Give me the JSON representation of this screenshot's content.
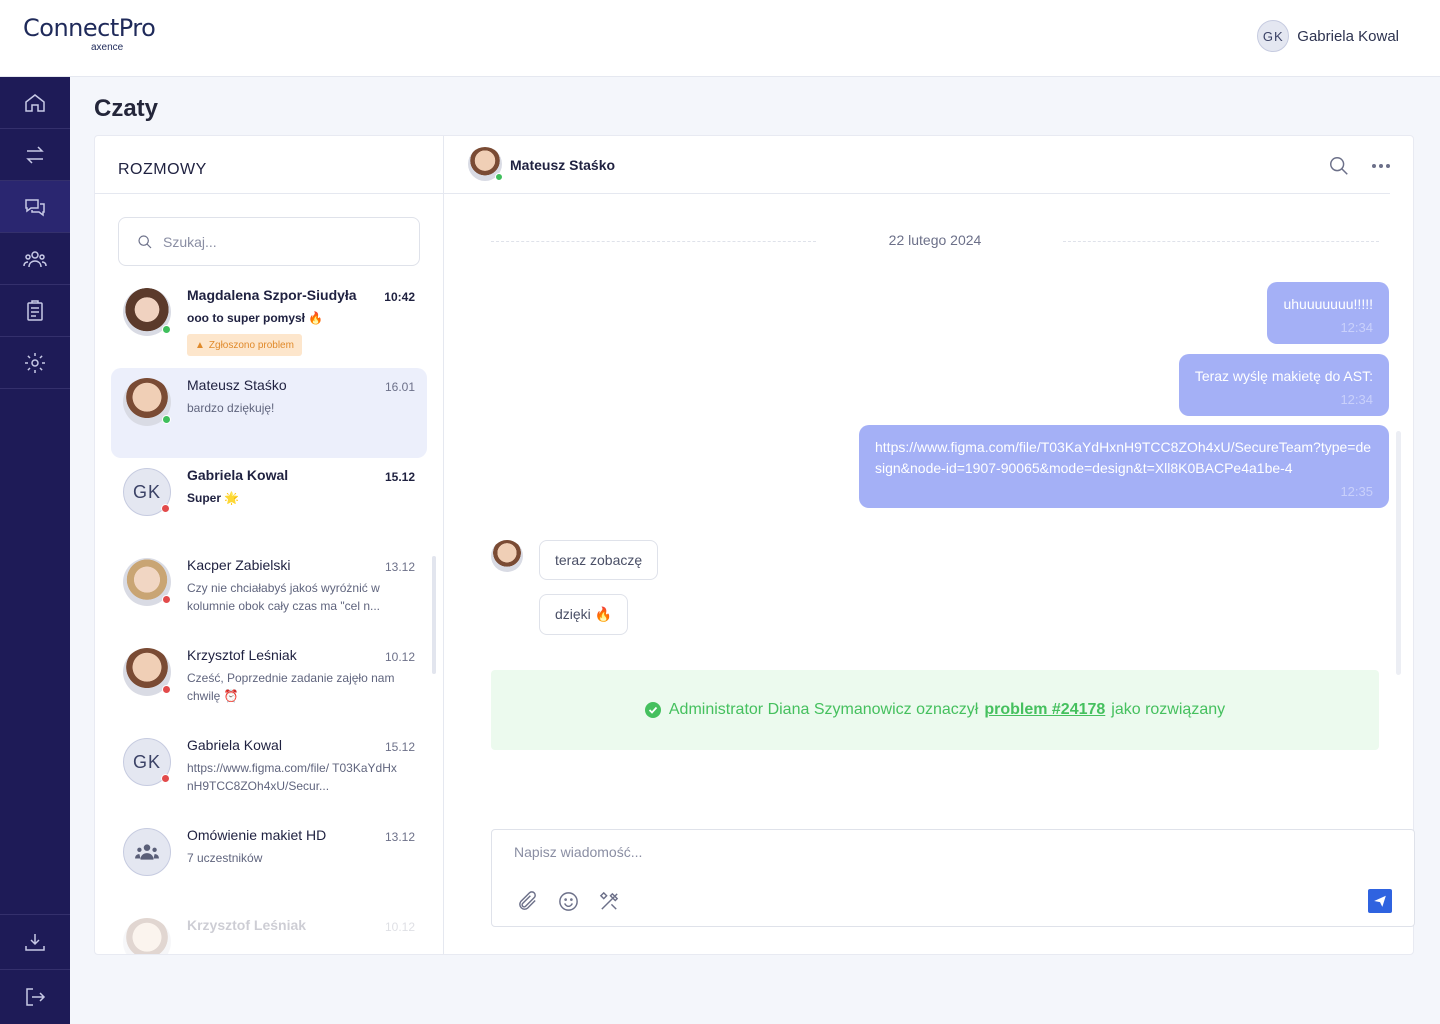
{
  "app": {
    "logo": "ConnectPro",
    "logo_sub": "axence"
  },
  "user": {
    "initials": "GK",
    "name": "Gabriela Kowal"
  },
  "page": {
    "title": "Czaty"
  },
  "conversations": {
    "heading": "ROZMOWY",
    "search_placeholder": "Szukaj...",
    "items": [
      {
        "name": "Magdalena Szpor-Siudyła",
        "time": "10:42",
        "message": "ooo to super pomysł 🔥",
        "badge": "Zgłoszono problem",
        "status": "online"
      },
      {
        "name": "Mateusz Staśko",
        "time": "16.01",
        "message": "bardzo dziękuję!",
        "status": "online"
      },
      {
        "initials": "GK",
        "name": "Gabriela Kowal",
        "time": "15.12",
        "message": "Super 🌟",
        "status": "offline"
      },
      {
        "name": "Kacper Zabielski",
        "time": "13.12",
        "message": "Czy nie chciałabyś jakoś wyróżnić w kolumnie  obok cały czas  ma \"cel n...",
        "status": "offline"
      },
      {
        "name": "Krzysztof Leśniak",
        "time": "10.12",
        "message": "Cześć, Poprzednie zadanie zajęło nam chwilę ⏰",
        "status": "offline"
      },
      {
        "initials": "GK",
        "name": "Gabriela Kowal",
        "time": "15.12",
        "message": "https://www.figma.com/file/ T03KaYdHxnH9TCC8ZOh4xU/Secur...",
        "status": "offline"
      },
      {
        "name": "Omówienie makiet HD",
        "time": "13.12",
        "message": "7 uczestników"
      },
      {
        "name": "Krzysztof Leśniak",
        "time": "10.12"
      }
    ]
  },
  "chat": {
    "contact_name": "Mateusz Staśko",
    "date": "22 lutego 2024",
    "outgoing": [
      {
        "text": "uhuuuuuuu!!!!!",
        "time": "12:34"
      },
      {
        "text": "Teraz wyślę makietę do AST:",
        "time": "12:34"
      },
      {
        "text": "https://www.figma.com/file/T03KaYdHxnH9TCC8ZOh4xU/SecureTeam?type=design&node-id=1907-90065&mode=design&t=Xll8K0BACPe4a1be-4",
        "time": "12:35"
      }
    ],
    "incoming": [
      {
        "text": "teraz zobaczę"
      },
      {
        "text": "dzięki 🔥"
      }
    ],
    "resolved": {
      "prefix": "Administrator Diana Szymanowicz oznaczył",
      "link": "problem #24178",
      "suffix": "jako rozwiązany"
    },
    "composer_placeholder": "Napisz wiadomość..."
  }
}
